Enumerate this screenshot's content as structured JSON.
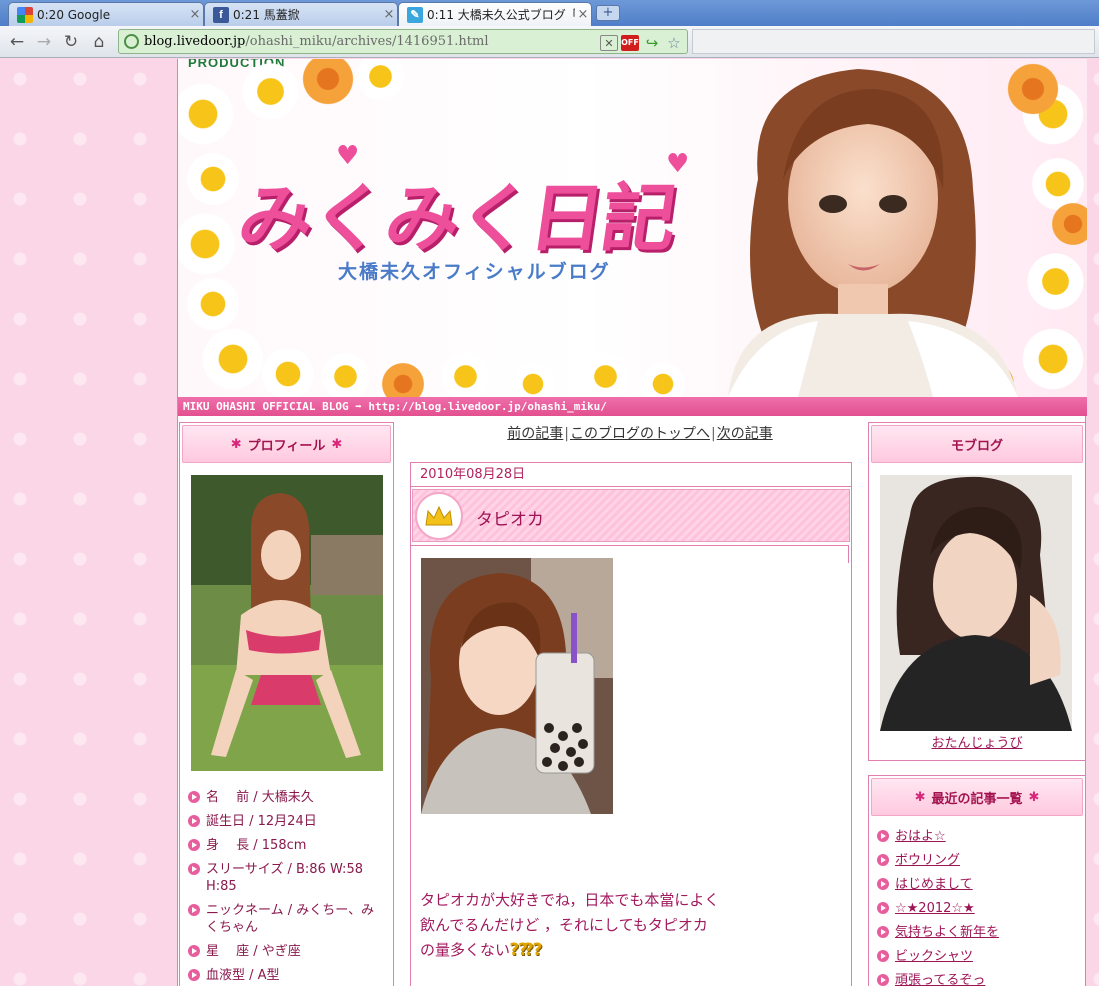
{
  "browser": {
    "tabs": [
      {
        "label": "0:20 Google",
        "favicon": "google-favicon",
        "active": false
      },
      {
        "label": "0:21 馬蓋掀",
        "favicon": "facebook-favicon",
        "active": false
      },
      {
        "label": "0:11 大橋未久公式ブログ「",
        "favicon": "blog-favicon",
        "active": true
      }
    ],
    "close_glyph": "×",
    "newtab_glyph": "+",
    "url_host": "blog.livedoor.jp",
    "url_path": "/ohashi_miku/archives/1416951.html",
    "extension_off_label": "OFF"
  },
  "header": {
    "production_logo": "PRODUCTION",
    "title": "みくみく日記",
    "subtitle": "大橋未久オフィシャルブログ",
    "strip_text": "MIKU OHASHI OFFICIAL BLOG ➡ http://blog.livedoor.jp/ohashi_miku/"
  },
  "profile": {
    "heading": "プロフィール",
    "ornament": "✱",
    "items": [
      "名　 前 / 大橋未久",
      "誕生日 / 12月24日",
      "身　 長 / 158cm",
      "スリーサイズ / B:86 W:58 H:85",
      "ニックネーム / みくちー、みくちゃん",
      "星　 座 / やぎ座",
      "血液型 / A型"
    ]
  },
  "nav": {
    "prev": "前の記事",
    "top": "このブログのトップへ",
    "next": "次の記事",
    "separator": "|"
  },
  "entry": {
    "date": "2010年08月28日",
    "title": "タピオカ",
    "body": "タピオカが大好きでね，日本でも本當によく飲んでるんだけど ，それにしてもタピオカの量多くない",
    "emoji": "⁇⁇"
  },
  "moblog": {
    "heading": "モブログ",
    "caption": "おたんじょうび"
  },
  "recent": {
    "heading": "最近の記事一覧",
    "ornament": "✱",
    "items": [
      "おはよ☆",
      "ボウリング",
      "はじめまして",
      "☆★2012☆★",
      "気持ちよく新年を",
      "ビックシャツ",
      "頑張ってるぞっ"
    ]
  },
  "colors": {
    "accent_pink": "#e85e9d",
    "link_pink": "#9d1455",
    "page_bg": "#fbd6e6"
  }
}
